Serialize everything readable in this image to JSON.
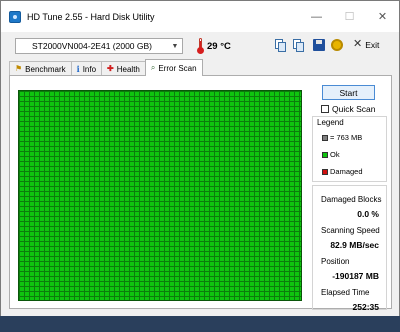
{
  "window": {
    "title": "HD Tune 2.55 - Hard Disk Utility",
    "min_glyph": "—",
    "max_glyph": "☐",
    "close_glyph": "✕"
  },
  "toolbar": {
    "drive": "ST2000VN004-2E41 (2000 GB)",
    "temperature": "29 °C",
    "exit_label": "Exit"
  },
  "tabs": [
    {
      "label": "Benchmark",
      "icon": "⚑"
    },
    {
      "label": "Info",
      "icon": "i"
    },
    {
      "label": "Health",
      "icon": "✚"
    },
    {
      "label": "Error Scan",
      "icon": "⌕",
      "active": true
    }
  ],
  "scan": {
    "start_label": "Start",
    "quick_scan_label": "Quick Scan",
    "quick_scan_checked": false,
    "block_color": "#0fc50f",
    "grid_line_color": "#0c7d0c"
  },
  "legend": {
    "title": "Legend",
    "items": [
      {
        "label": "= 763 MB",
        "color": "#7f7f7f"
      },
      {
        "label": "Ok",
        "color": "#0fc50f"
      },
      {
        "label": "Damaged",
        "color": "#d01010"
      }
    ]
  },
  "stats": {
    "damaged_blocks_label": "Damaged Blocks",
    "damaged_blocks_value": "0.0 %",
    "scanning_speed_label": "Scanning Speed",
    "scanning_speed_value": "82.9 MB/sec",
    "position_label": "Position",
    "position_value": "-190187 MB",
    "elapsed_label": "Elapsed Time",
    "elapsed_value": "252:35"
  }
}
